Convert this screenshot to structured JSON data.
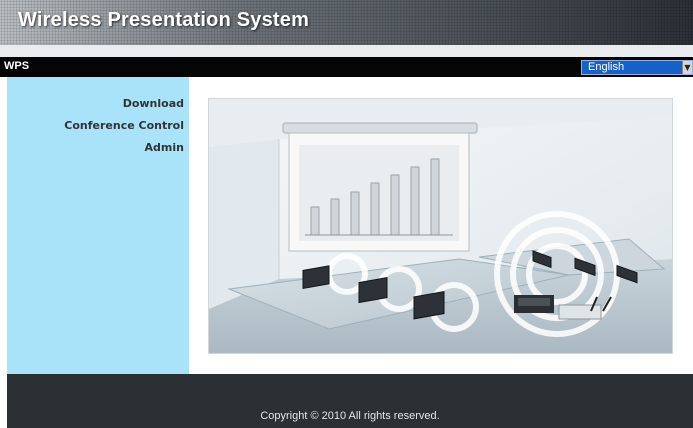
{
  "header": {
    "title": "Wireless Presentation System"
  },
  "topbar": {
    "app_label": "WPS",
    "language": {
      "selected": "English"
    }
  },
  "sidebar": {
    "items": [
      {
        "label": "Download"
      },
      {
        "label": "Conference Control"
      },
      {
        "label": "Admin"
      }
    ]
  },
  "footer": {
    "copyright": "Copyright © 2010 All rights reserved."
  },
  "colors": {
    "sidebar_bg": "#a9e3fa",
    "topbar_bg": "#050505",
    "footer_bg": "#2b3035",
    "select_bg": "#1660c9"
  },
  "icons": [
    "dropdown-arrow-icon",
    "screen-icon",
    "laptop-icon",
    "projector-icon",
    "wireless-signal-icon"
  ]
}
